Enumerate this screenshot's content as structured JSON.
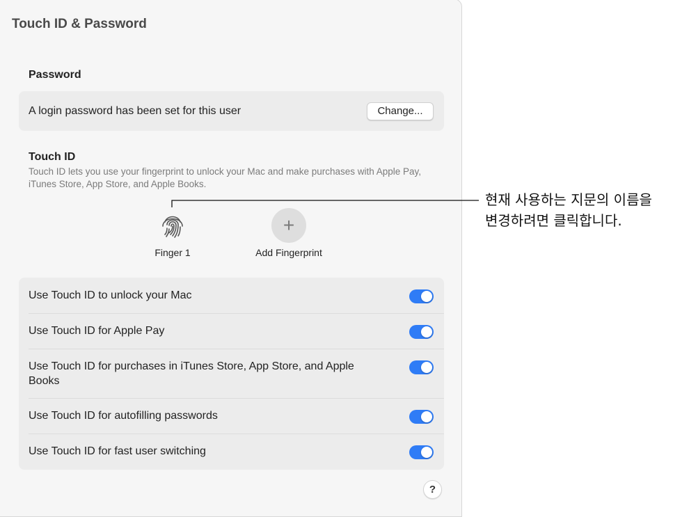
{
  "window": {
    "title": "Touch ID & Password"
  },
  "password": {
    "heading": "Password",
    "status_text": "A login password has been set for this user",
    "change_label": "Change..."
  },
  "touch_id": {
    "heading": "Touch ID",
    "description": "Touch ID lets you use your fingerprint to unlock your Mac and make purchases with Apple Pay, iTunes Store, App Store, and Apple Books.",
    "fingerprints": [
      {
        "label": "Finger 1",
        "icon": "fingerprint-icon"
      }
    ],
    "add_label": "Add Fingerprint",
    "add_icon": "plus-icon"
  },
  "options": [
    {
      "label": "Use Touch ID to unlock your Mac",
      "enabled": true
    },
    {
      "label": "Use Touch ID for Apple Pay",
      "enabled": true
    },
    {
      "label": "Use Touch ID for purchases in iTunes Store, App Store, and Apple Books",
      "enabled": true
    },
    {
      "label": "Use Touch ID for autofilling passwords",
      "enabled": true
    },
    {
      "label": "Use Touch ID for fast user switching",
      "enabled": true
    }
  ],
  "help": {
    "label": "?"
  },
  "callout": {
    "line1": "현재 사용하는 지문의 이름을",
    "line2": "변경하려면 클릭합니다."
  },
  "colors": {
    "accent": "#2f7cf6",
    "panel": "#ececec",
    "window": "#f6f6f6"
  }
}
